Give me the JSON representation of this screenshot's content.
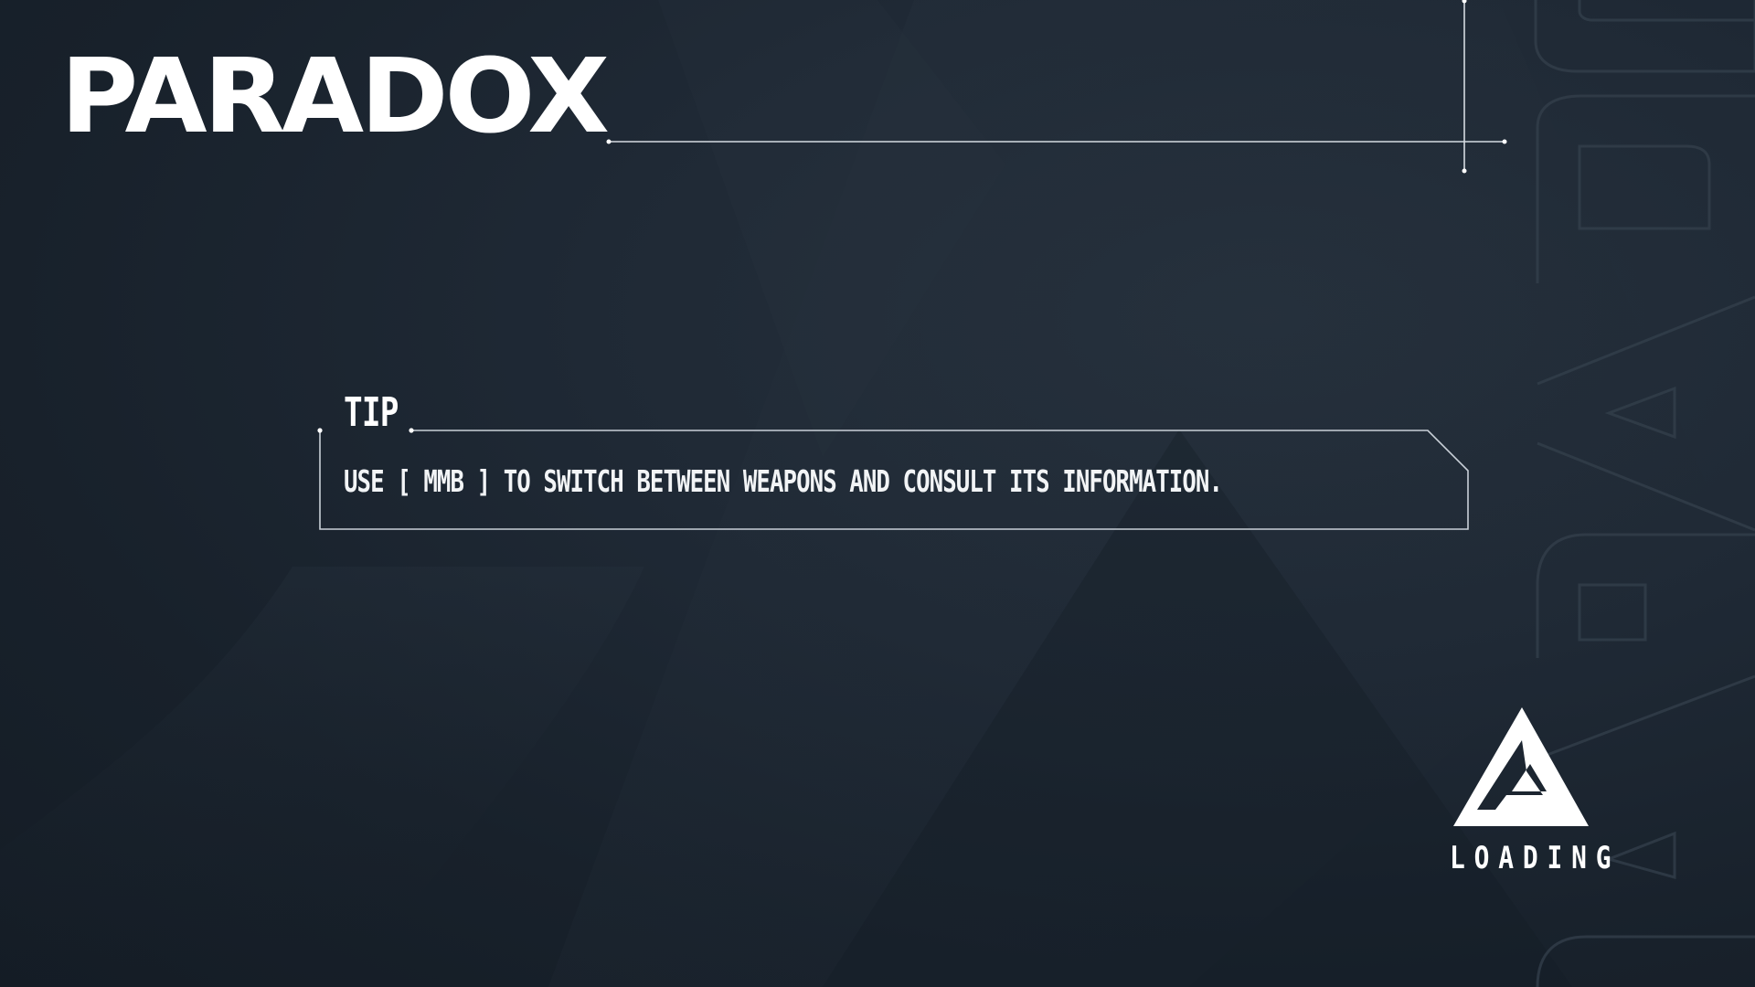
{
  "header": {
    "title": "PARADOX"
  },
  "tip": {
    "label": "TIP",
    "text": "USE  [ MMB ]  TO SWITCH BETWEEN WEAPONS AND CONSULT ITS INFORMATION."
  },
  "loading": {
    "label": "LOADING",
    "icon": "triangle-logo-icon"
  },
  "background": {
    "watermark_text": "PARADOX",
    "colors": {
      "base": "#1a2430",
      "accent": "#ffffff",
      "frame_line": "#c9d0d8"
    }
  }
}
